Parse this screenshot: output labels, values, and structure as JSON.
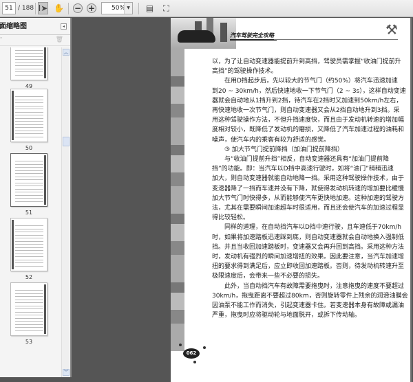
{
  "toolbar": {
    "page_current": "51",
    "page_total": "/ 188",
    "zoom": "50%"
  },
  "sidebar": {
    "title": "页面缩略图",
    "thumbnails": [
      "49",
      "50",
      "51",
      "52",
      "53"
    ]
  },
  "document": {
    "header_title": "汽车驾驶完全攻略",
    "page_number": "062",
    "lines": [
      "以，为了让自动变速器能提前升到高挡，驾驶员需掌握“收油门提前升",
      "高挡”的驾驶操作技术。",
      "在用D挡起步后，先以较大的节气门（约50%）将汽车迅速加速",
      "到20 ~ 30km/h，然后快速地收一下节气门（2 ~ 3s），这样自动变速",
      "器就会自动地从1挡升到2挡，待汽车在2挡时又加速到50km/h左右，",
      "再快速地收一次节气门，则自动变速器又会从2挡自动地升到3挡。采",
      "用这种驾驶操作方法，不但升挡速度快，而且由于发动机转速的增加幅",
      "度相对较小，既降低了发动机的磨损，又降低了汽车加速过程的油耗和",
      "噪声，使汽车内的乘客有较为舒适的感觉。",
      "③ 加大节气门提前降挡（加油门提前降挡）",
      "与“收油门提前升挡”相反，自动变速器还具有“加油门提前降",
      "挡”的功能。即：当汽车以D挡中高速行驶时，如将“油门”稍稍迅速",
      "加大，则自动变速器就能自动地降一挡。采用这种驾驶操作技术，由于",
      "变速器降了一挡而车速并没有下降，就使得发动机转速的增加要比缓慢",
      "加大节气门时快得多，从而能够使汽车更快地加速。这种加速的驾驶方",
      "法，尤其在需要瞬间加速超车时很适用，而且还会使汽车的加速过程显",
      "得比较轻松。",
      "同样的道理，在自动挡汽车以D挡中速行驶，且车速低于70km/h",
      "时，如果将加速踏板迅速踩到底，则自动变速器就会自动地换入强制低",
      "挡。并且当收回加速踏板时，变速器又会再升回到高挡。采用这种方法",
      "时，发动机有强烈的瞬间加速增扭的效果。因此要注意，当汽车加速增",
      "扭的要求得到满足后，应立即收回加速踏板。否则，待发动机转速升至",
      "极限速度后，会带来一些不必要的损失。",
      "此外，当自动挡汽车有故障需要拖曳时，注意拖曳的速度不要超过",
      "30km/h，拖曳距离不要超过80km，否则旋转零件上残余的润滑油膜会",
      "因油泵不能工作而消失，引起变速器卡住。若变速器本身有故障或漏油",
      "严重，拖曳时应将驱动轮与地面脱开，或拆下传动轴。"
    ]
  }
}
